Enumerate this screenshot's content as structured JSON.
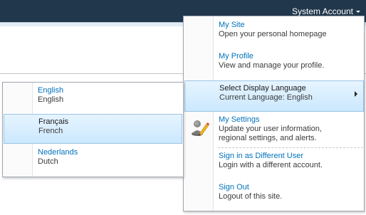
{
  "header": {
    "account_label": "System Account",
    "account_icon": "chevron-down-icon"
  },
  "menu": {
    "items": [
      {
        "title": "My Site",
        "description": [
          "Open your personal homepage"
        ]
      },
      {
        "title": "My Profile",
        "description": [
          "View and manage your profile."
        ]
      },
      {
        "title": "Select Display Language",
        "description": [
          "Current Language: English"
        ],
        "has_submenu": true,
        "highlighted": true
      },
      {
        "title": "My Settings",
        "description": [
          "Update your user information,",
          "regional settings, and alerts."
        ],
        "icon": "user-settings-icon"
      },
      {
        "title": "Sign in as Different User",
        "description": [
          "Login with a different account."
        ]
      },
      {
        "title": "Sign Out",
        "description": [
          "Logout of this site."
        ]
      }
    ]
  },
  "language_menu": {
    "items": [
      {
        "name": "English",
        "english_name": "English",
        "highlighted": false
      },
      {
        "name": "Français",
        "english_name": "French",
        "highlighted": true
      },
      {
        "name": "Nederlands",
        "english_name": "Dutch",
        "highlighted": false
      }
    ]
  },
  "colors": {
    "topbar": "#21374c",
    "link": "#0072bc",
    "highlight": "#cbe8fd"
  }
}
